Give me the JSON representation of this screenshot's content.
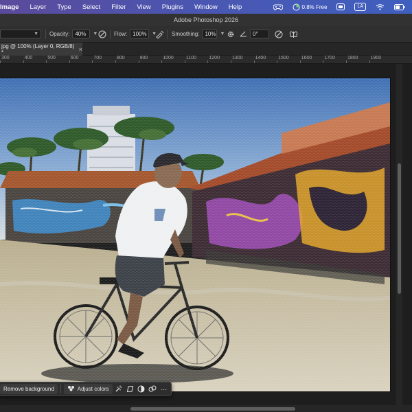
{
  "menubar": {
    "menus": [
      "Image",
      "Layer",
      "Type",
      "Select",
      "Filter",
      "View",
      "Plugins",
      "Window",
      "Help"
    ],
    "memory_text": "0.8% Free",
    "user_badge": "LA",
    "icons": [
      "gamepad-icon",
      "memory-icon",
      "window-switch-icon",
      "la-badge",
      "wifi-icon",
      "battery-icon"
    ]
  },
  "window": {
    "title": "Adobe Photoshop 2026"
  },
  "options_bar": {
    "opacity_label": "Opacity:",
    "opacity_value": "40%",
    "flow_label": "Flow:",
    "flow_value": "100%",
    "smoothing_label": "Smoothing:",
    "smoothing_value": "10%",
    "angle_value": "0°"
  },
  "document": {
    "tab_title": "jpg @ 100% (Layer 0, RGB/8) *",
    "close_glyph": "×"
  },
  "ruler": {
    "ticks": [
      "300",
      "400",
      "500",
      "600",
      "700",
      "800",
      "900",
      "1000",
      "1100",
      "1200",
      "1300",
      "1400",
      "1500",
      "1600",
      "1700",
      "1800",
      "1900"
    ]
  },
  "contextual_taskbar": {
    "remove_background": "Remove background",
    "adjust_colors": "Adjust colors",
    "more": "···"
  },
  "colors": {
    "menubar_start": "#5b4a9c",
    "menubar_end": "#3f5fbf",
    "panel_bg": "#2f2f2f",
    "workspace_bg": "#1e1e1e"
  }
}
